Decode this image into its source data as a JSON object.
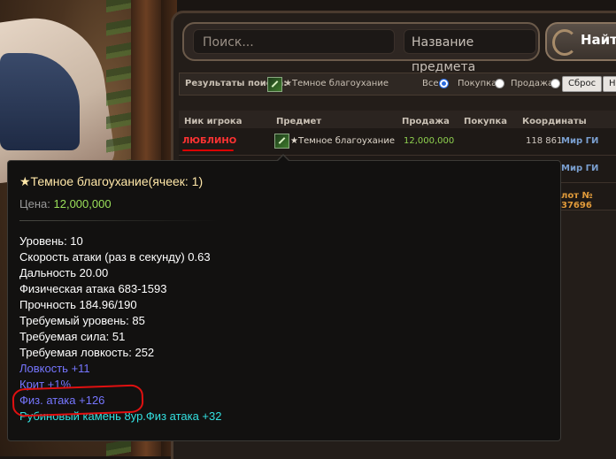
{
  "search": {
    "placeholder": "Поиск...",
    "type_label": "Название предмета",
    "find_button": "Найти"
  },
  "filter": {
    "results_label": "Результаты поиска:",
    "item_icon": "weapon-icon",
    "item_name": "★Темное благоухание",
    "opt_all": "Все",
    "opt_buy": "Покупка",
    "opt_sell": "Продажа",
    "selected": "all",
    "reset_button": "Сброс",
    "back_button": "Наз"
  },
  "table": {
    "headers": {
      "nick": "Ник игрока",
      "item": "Предмет",
      "sell": "Продажа",
      "buy": "Покупка",
      "coords": "Координаты"
    },
    "rows": [
      {
        "nick": "ЛЮБЛИНО",
        "item": "★Темное благоухание",
        "price": "12,000,000",
        "coord": "118 861",
        "location": "Мир ГИ"
      },
      {
        "location": "Мир ГИ"
      },
      {
        "location": "лот № 37696"
      }
    ]
  },
  "tooltip": {
    "title": "★Темное благоухание(ячеек: 1)",
    "price_label": "Цена:",
    "price_value": "12,000,000",
    "lines": [
      "Уровень: 10",
      "Скорость атаки (раз в секунду) 0.63",
      "Дальность 20.00",
      "Физическая атака 683-1593",
      "Прочность 184.96/190",
      "Требуемый уровень: 85",
      "Требуемая сила: 51",
      "Требуемая ловкость: 252",
      "Ловкость +11",
      "Крит +1%",
      "Физ. атака +126",
      "Рубиновый камень 8ур.Физ атака +32"
    ]
  },
  "colors": {
    "accent_blue": "#7676ff",
    "accent_cyan": "#33e0e0",
    "price_green": "#9be05a",
    "nick_red": "#ff3333",
    "highlight_circle": "#e01010"
  }
}
